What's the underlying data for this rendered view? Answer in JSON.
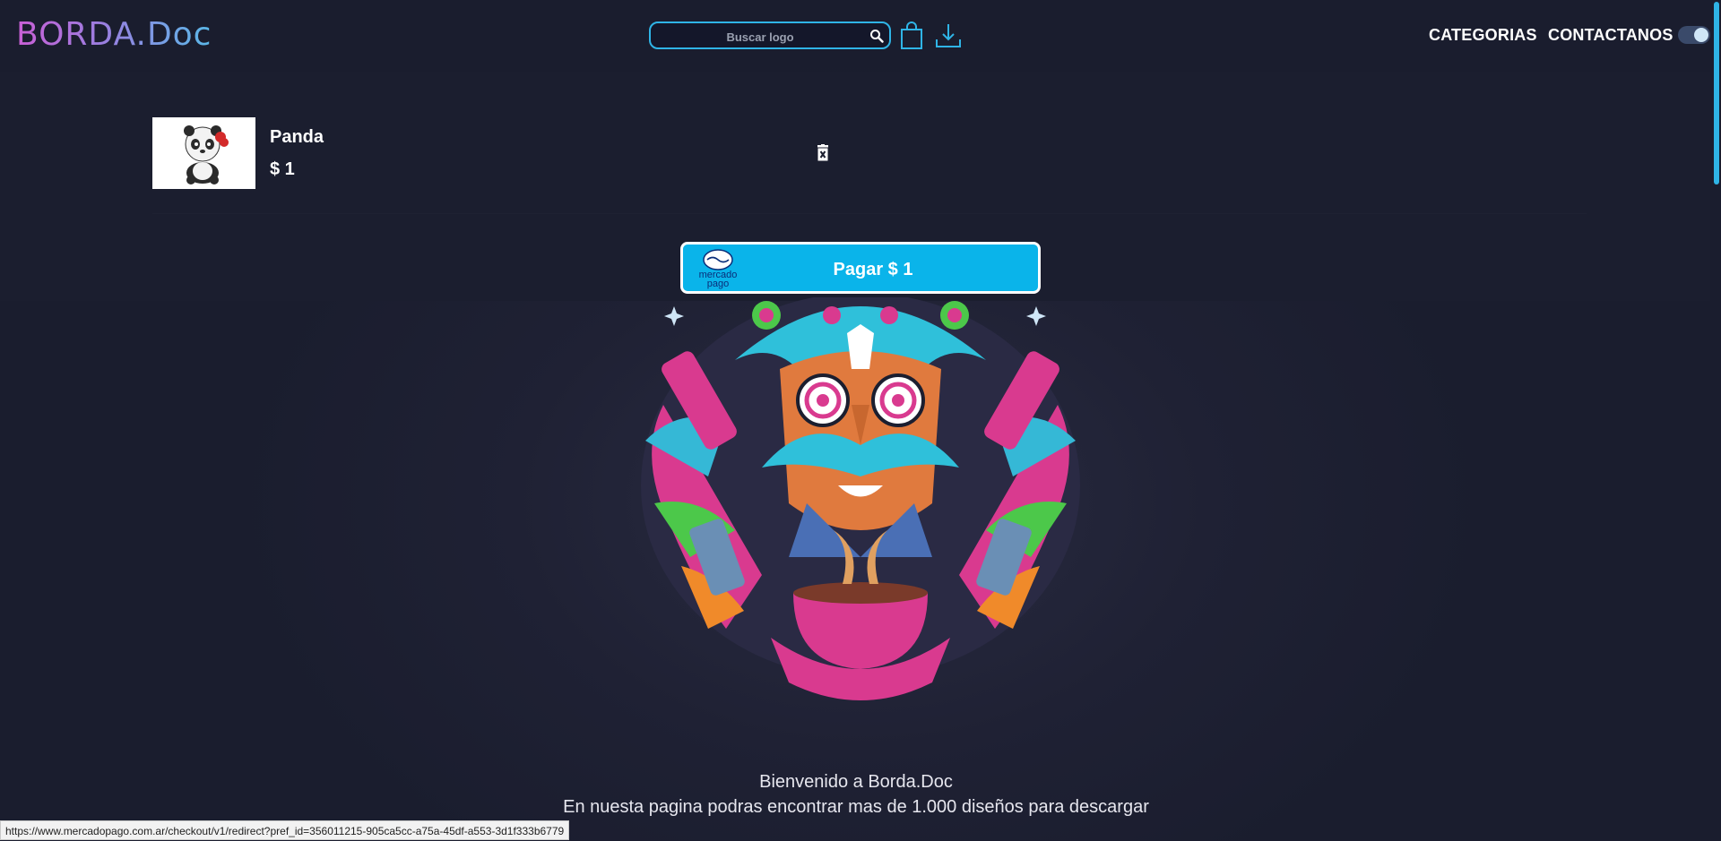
{
  "header": {
    "logo": "BORDA.Doc",
    "search_placeholder": "Buscar logo",
    "nav": {
      "categories": "CATEGORIAS",
      "contact": "CONTACTANOS"
    },
    "icons": {
      "search": "search-icon",
      "cart": "shopping-bag-icon",
      "download": "download-icon",
      "theme_toggle": "toggle-switch"
    }
  },
  "cart": {
    "items": [
      {
        "name": "Panda",
        "price": "$ 1",
        "image": "panda-logo"
      }
    ],
    "pay_button_label": "Pagar $ 1",
    "payment_provider": "mercado pago"
  },
  "main": {
    "welcome": "Bienvenido a Borda.Doc",
    "subtitle": "En nuesta pagina podras encontrar mas de 1.000 diseños para descargar"
  },
  "status_bar": {
    "url": "https://www.mercadopago.com.ar/checkout/v1/redirect?pref_id=356011215-905ca5cc-a75a-45df-a553-3d1f333b6779"
  },
  "colors": {
    "background": "#1a1d2e",
    "accent": "#2fb4e6",
    "pay_button": "#0ab4ea"
  }
}
